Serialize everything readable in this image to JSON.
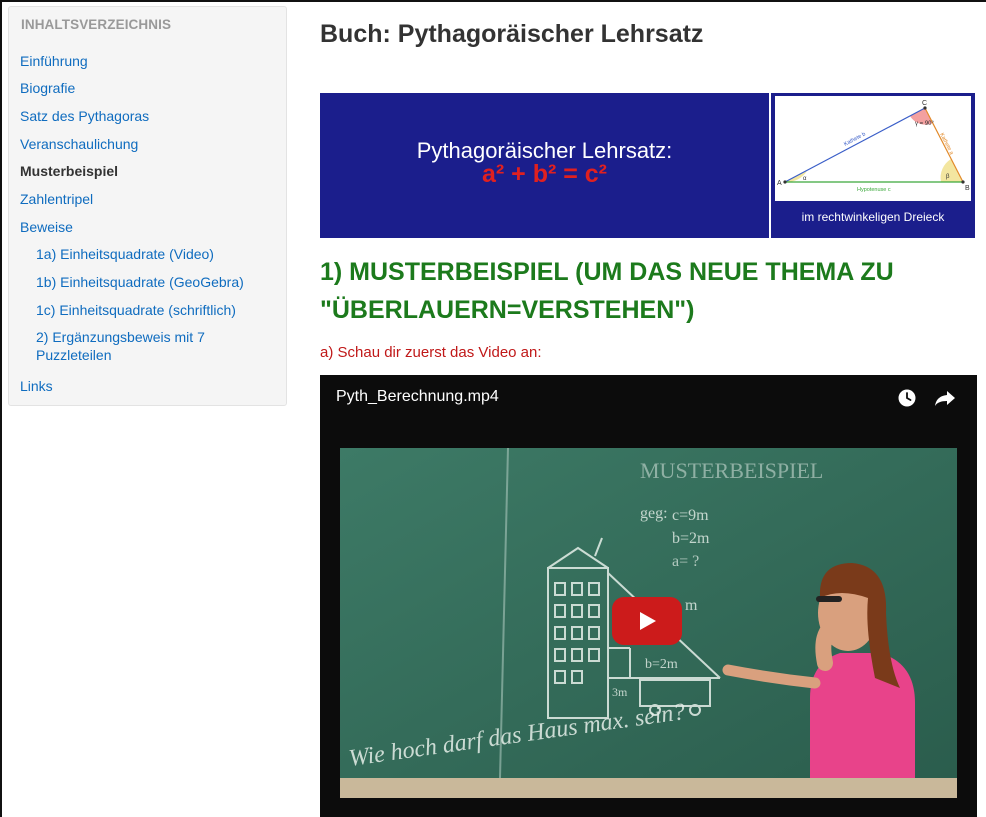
{
  "sidebar": {
    "heading": "INHALTSVERZEICHNIS",
    "items": [
      {
        "label": "Einführung"
      },
      {
        "label": "Biografie"
      },
      {
        "label": "Satz des Pythagoras"
      },
      {
        "label": "Veranschaulichung"
      },
      {
        "label": "Musterbeispiel",
        "active": true
      },
      {
        "label": "Zahlentripel"
      },
      {
        "label": "Beweise"
      },
      {
        "label": "1a) Einheitsquadrate (Video)"
      },
      {
        "label": "1b) Einheitsquadrate (GeoGebra)"
      },
      {
        "label": "1c) Einheitsquadrate (schriftlich)"
      },
      {
        "label": "2) Ergänzungsbeweis mit 7 Puzzleteilen"
      },
      {
        "label": "Links"
      }
    ]
  },
  "main": {
    "book_title": "Buch: Pythagoräischer Lehrsatz",
    "banner": {
      "text": "Pythagoräischer Lehrsatz:",
      "formula": "a² + b² = c²",
      "caption": "im rechtwinkeligen Dreieck",
      "triangle_labels": {
        "a": "A",
        "b": "B",
        "c": "C",
        "kathete_b": "Kathete b",
        "kathete_a": "Kathete a",
        "hypotenuse": "Hypotenuse c",
        "gamma": "γ = 90°",
        "alpha": "α",
        "beta": "β"
      }
    },
    "section_heading_line1": "1) MUSTERBEISPIEL (UM DAS NEUE THEMA ZU",
    "section_heading_line2": "\"ÜBERLAUERN=VERSTEHEN\")",
    "intro": "a) Schau dir zuerst das Video an:",
    "video": {
      "title": "Pyth_Berechnung.mp4",
      "board": {
        "heading": "MUSTERBEISPIEL",
        "geg": "geg:",
        "c_line": "c=9m",
        "b_line": "b=2m",
        "a_line": "a= ?",
        "m_label": "m",
        "b_mid": "b=2m",
        "three_m": "3m",
        "question": "Wie hoch darf das Haus max. sein?"
      }
    }
  },
  "colors": {
    "link": "#0f6cbf",
    "heading_green": "#1c7a1c",
    "intro_red": "#c01818",
    "banner_blue": "#1b1e8c",
    "formula_red": "#e02020",
    "play_red": "#cc1b1b"
  }
}
